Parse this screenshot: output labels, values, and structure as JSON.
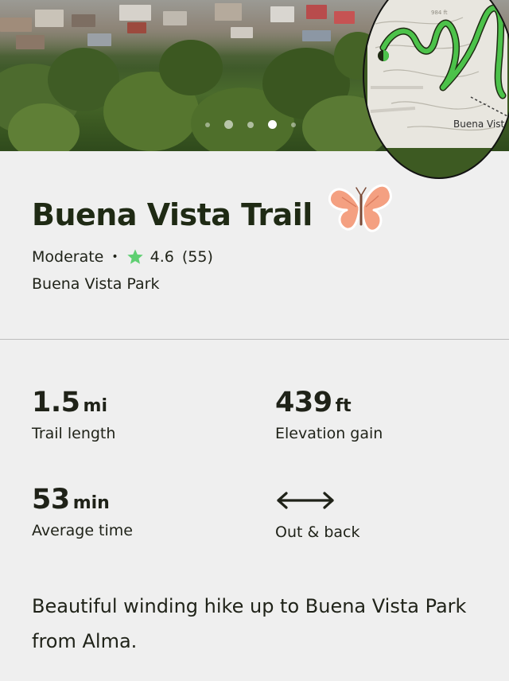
{
  "hero": {
    "carousel_dots": 5,
    "active_dot_index": 3,
    "map_label": "Buena Vista",
    "map_elevation": "984 ft"
  },
  "trail": {
    "name": "Buena Vista Trail",
    "difficulty": "Moderate",
    "separator": "•",
    "rating": "4.6",
    "review_count": "(55)",
    "park": "Buena Vista Park"
  },
  "stats": {
    "length": {
      "value": "1.5",
      "unit": "mi",
      "label": "Trail length"
    },
    "elevation": {
      "value": "439",
      "unit": "ft",
      "label": "Elevation gain"
    },
    "time": {
      "value": "53",
      "unit": "min",
      "label": "Average time"
    },
    "route": {
      "label": "Out & back",
      "icon": "double-arrow-icon"
    }
  },
  "description": "Beautiful winding hike up to Buena Vista Park from Alma.",
  "colors": {
    "background": "#efefef",
    "text": "#1f2218",
    "star": "#5fcf72",
    "trail_line": "#4cc24a",
    "butterfly": "#f4a081"
  }
}
